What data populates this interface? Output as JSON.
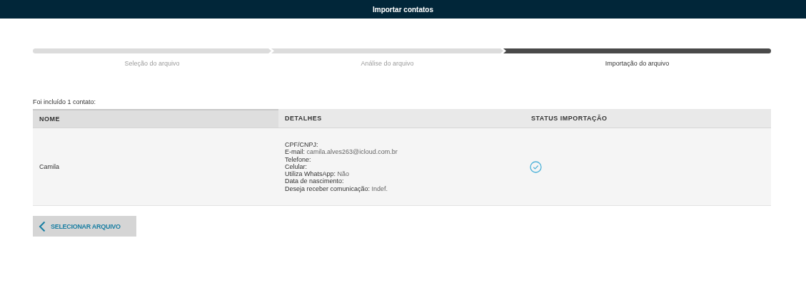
{
  "header": {
    "title": "Importar contatos"
  },
  "steps": [
    {
      "label": "Seleção do arquivo",
      "selected": false
    },
    {
      "label": "Análise do arquivo",
      "selected": false
    },
    {
      "label": "Importação do arquivo",
      "selected": true
    }
  ],
  "summary": "Foi incluído 1 contato:",
  "table": {
    "columns": [
      "NOME",
      "DETALHES",
      "STATUS IMPORTAÇÃO"
    ],
    "rows": [
      {
        "name": "Camila",
        "details": [
          {
            "label": "CPF/CNPJ:"
          },
          {
            "label": "E-mail:",
            "value": "camila.alves263@icloud.com.br"
          },
          {
            "label": "Telefone:"
          },
          {
            "label": "Celular:"
          },
          {
            "label": "Utiliza WhatsApp:",
            "value": "Não"
          },
          {
            "label": "Data de nascimento:"
          },
          {
            "label": "Deseja receber comunicação:",
            "value": "Indef."
          }
        ],
        "imported": true
      }
    ]
  },
  "back_button": {
    "label": "SELECIONAR ARQUIVO"
  }
}
